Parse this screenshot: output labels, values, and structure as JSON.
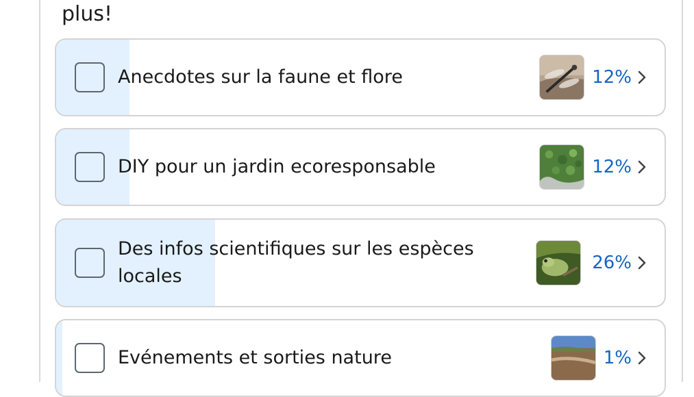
{
  "poll": {
    "question_tail": "plus!",
    "options": [
      {
        "label": "Anecdotes sur la faune et flore",
        "percent": "12%",
        "share": 0.12,
        "thumb_icon": "dragonfly-photo",
        "selected": false
      },
      {
        "label": "DIY pour un jardin ecoresponsable",
        "percent": "12%",
        "share": 0.12,
        "thumb_icon": "moss-plant-photo",
        "selected": false
      },
      {
        "label": "Des infos scientifiques sur les espèces locales",
        "percent": "26%",
        "share": 0.26,
        "thumb_icon": "tree-frog-photo",
        "selected": false
      },
      {
        "label": "Evénements et sorties nature",
        "percent": "1%",
        "share": 0.01,
        "thumb_icon": "landscape-photo",
        "selected": false
      }
    ]
  },
  "colors": {
    "accent": "#1565c0",
    "result_fill": "#e3f1ff",
    "border": "#d4d4d4"
  }
}
